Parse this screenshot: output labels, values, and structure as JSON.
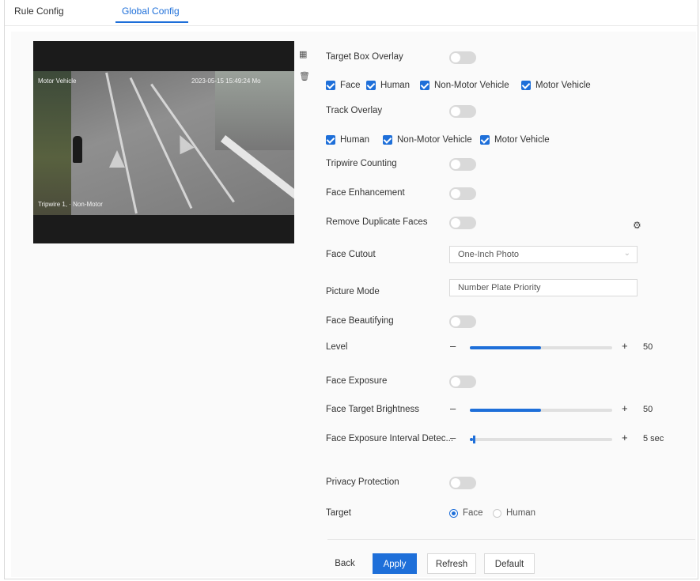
{
  "tabs": [
    {
      "label": "Rule Config",
      "active": false
    },
    {
      "label": "Global Config",
      "active": true
    }
  ],
  "video": {
    "osd_top_left": "Motor Vehicle",
    "osd_top_right": "2023-05-15 15:49:24 Mo",
    "osd_bottom_left": "Tripwire 1,  · Non-Motor"
  },
  "settings": {
    "target_box_overlay": {
      "label": "Target Box Overlay",
      "on": false
    },
    "target_box_types": [
      "Face",
      "Human",
      "Non-Motor Vehicle",
      "Motor Vehicle"
    ],
    "track_overlay": {
      "label": "Track Overlay",
      "on": false
    },
    "track_types": [
      "Human",
      "Non-Motor Vehicle",
      "Motor Vehicle"
    ],
    "tripwire_counting": {
      "label": "Tripwire Counting",
      "on": false
    },
    "face_enhancement": {
      "label": "Face Enhancement",
      "on": false
    },
    "remove_duplicate_faces": {
      "label": "Remove Duplicate Faces",
      "on": false
    },
    "face_cutout": {
      "label": "Face Cutout",
      "value": "One-Inch Photo"
    },
    "picture_mode": {
      "label": "Picture Mode",
      "value": "Number Plate Priority"
    },
    "face_beautifying": {
      "label": "Face Beautifying",
      "on": false
    },
    "level": {
      "label": "Level",
      "value": "50",
      "fraction": 0.5
    },
    "face_exposure": {
      "label": "Face Exposure",
      "on": false
    },
    "face_target_brightness": {
      "label": "Face Target Brightness",
      "value": "50",
      "fraction": 0.5
    },
    "face_exposure_interval": {
      "label": "Face Exposure Interval Detec...",
      "value": "5 sec",
      "fraction": 0.02
    },
    "privacy_protection": {
      "label": "Privacy Protection",
      "on": false
    },
    "target": {
      "label": "Target",
      "options": [
        "Face",
        "Human"
      ],
      "selected": "Face"
    }
  },
  "buttons": {
    "back": "Back",
    "apply": "Apply",
    "refresh": "Refresh",
    "default": "Default"
  },
  "colors": {
    "accent": "#1e6fd9"
  }
}
